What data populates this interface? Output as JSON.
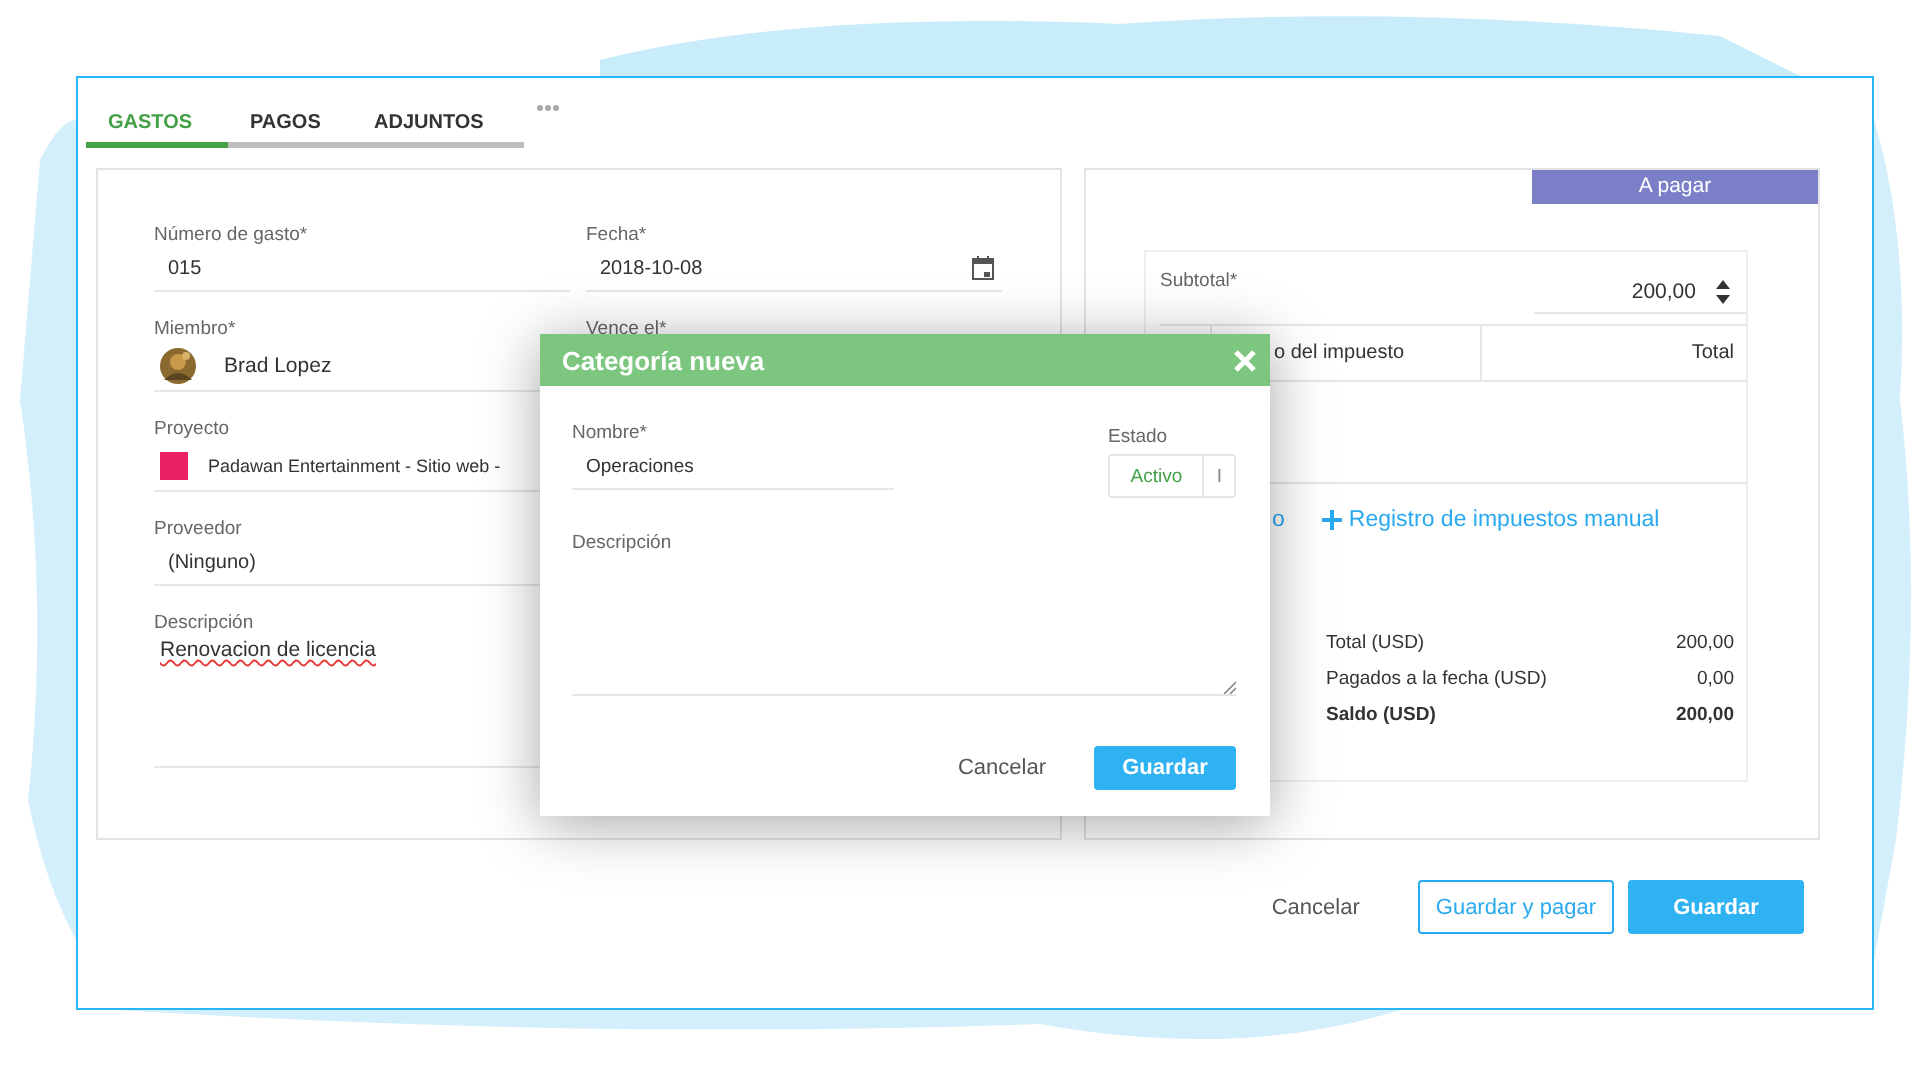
{
  "tabs": [
    {
      "label": "GASTOS",
      "selected": true
    },
    {
      "label": "PAGOS",
      "selected": false
    },
    {
      "label": "ADJUNTOS",
      "selected": false
    }
  ],
  "expense_form": {
    "fields": [
      {
        "label": "Número de gasto*",
        "value": "015",
        "kind": "text"
      },
      {
        "label": "Fecha*",
        "value": "2018-10-08",
        "kind": "date"
      },
      {
        "label": "Miembro*",
        "value": "Brad Lopez",
        "kind": "member"
      },
      {
        "label": "Vence el*",
        "kind": "covered"
      },
      {
        "label": "Proyecto",
        "value": "Padawan Entertainment - Sitio web -",
        "kind": "project"
      },
      {
        "label": "Proveedor",
        "value": "(Ninguno)",
        "kind": "text"
      },
      {
        "label": "Descripción",
        "value": "Renovacion de licencia",
        "kind": "textarea"
      }
    ]
  },
  "summary": {
    "status_badge": "A pagar",
    "subtotal_label": "Subtotal*",
    "subtotal_value": "200,00",
    "tax_columns": [
      "o del impuesto",
      "Total"
    ],
    "links": [
      "o",
      "Registro de impuestos manual"
    ],
    "totals": [
      {
        "label": "Total (USD)",
        "value": "200,00",
        "bold": false
      },
      {
        "label": "Pagados a la fecha (USD)",
        "value": "0,00",
        "bold": false
      },
      {
        "label": "Saldo (USD)",
        "value": "200,00",
        "bold": true
      }
    ]
  },
  "actions": [
    {
      "label": "Cancelar",
      "kind": "text"
    },
    {
      "label": "Guardar y pagar",
      "kind": "outline"
    },
    {
      "label": "Guardar",
      "kind": "primary"
    }
  ],
  "dialog": {
    "title": "Categoría nueva",
    "name_label": "Nombre*",
    "name_value": "Operaciones",
    "status_label": "Estado",
    "status_options": [
      {
        "label": "Activo",
        "selected": true
      },
      {
        "label": "I",
        "selected": false
      }
    ],
    "description_label": "Descripción",
    "buttons": [
      {
        "label": "Cancelar",
        "kind": "text"
      },
      {
        "label": "Guardar",
        "kind": "primary"
      }
    ]
  }
}
